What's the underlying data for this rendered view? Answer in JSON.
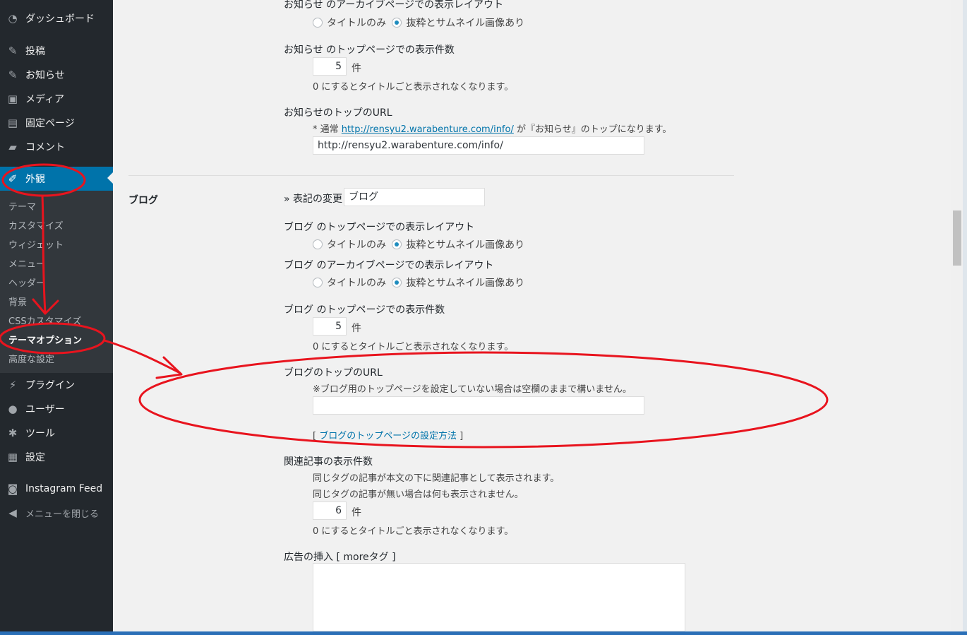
{
  "sidebar": {
    "items": [
      {
        "label": "ダッシュボード",
        "icon": "dashboard-icon"
      },
      {
        "label": "投稿",
        "icon": "pin-icon"
      },
      {
        "label": "お知らせ",
        "icon": "pin-icon"
      },
      {
        "label": "メディア",
        "icon": "media-icon"
      },
      {
        "label": "固定ページ",
        "icon": "page-icon"
      },
      {
        "label": "コメント",
        "icon": "comment-icon"
      },
      {
        "label": "外観",
        "icon": "brush-icon"
      },
      {
        "label": "プラグイン",
        "icon": "plugin-icon"
      },
      {
        "label": "ユーザー",
        "icon": "user-icon"
      },
      {
        "label": "ツール",
        "icon": "wrench-icon"
      },
      {
        "label": "設定",
        "icon": "settings-icon"
      },
      {
        "label": "Instagram Feed",
        "icon": "camera-icon"
      }
    ],
    "submenu": [
      "テーマ",
      "カスタマイズ",
      "ウィジェット",
      "メニュー",
      "ヘッダー",
      "背景",
      "CSSカスタマイズ",
      "テーマオプション",
      "高度な設定"
    ],
    "collapse_label": "メニューを閉じる"
  },
  "info": {
    "archive_layout_label": "お知らせ のアーカイブページでの表示レイアウト",
    "option_title_only": "タイトルのみ",
    "option_excerpt": "抜粋とサムネイル画像あり",
    "top_count_label": "お知らせ のトップページでの表示件数",
    "top_count_value": "5",
    "unit": "件",
    "zero_note": "0 にするとタイトルごと表示されなくなります。",
    "url_label": "お知らせのトップのURL",
    "url_note_prefix": "* 通常",
    "url_note_link": "http://rensyu2.warabenture.com/info/",
    "url_note_suffix": "が『お知らせ』のトップになります。",
    "url_value": "http://rensyu2.warabenture.com/info/"
  },
  "blog": {
    "section_title": "ブログ",
    "rename_label": "» 表記の変更",
    "rename_value": "ブログ",
    "top_layout_label": "ブログ のトップページでの表示レイアウト",
    "archive_layout_label": "ブログ のアーカイブページでの表示レイアウト",
    "option_title_only": "タイトルのみ",
    "option_excerpt": "抜粋とサムネイル画像あり",
    "top_count_label": "ブログ のトップページでの表示件数",
    "top_count_value": "5",
    "unit": "件",
    "zero_note": "0 にするとタイトルごと表示されなくなります。",
    "url_label": "ブログのトップのURL",
    "url_note": "※ブログ用のトップページを設定していない場合は空欄のままで構いません。",
    "url_value": "",
    "howto_open": "[",
    "howto_link": "ブログのトップページの設定方法",
    "howto_close": "]"
  },
  "related": {
    "label": "関連記事の表示件数",
    "note1": "同じタグの記事が本文の下に関連記事として表示されます。",
    "note2": "同じタグの記事が無い場合は何も表示されません。",
    "value": "6",
    "unit": "件",
    "zero_note": "0 にするとタイトルごと表示されなくなります。"
  },
  "ad": {
    "label": "広告の挿入 [ moreタグ ]"
  },
  "colors": {
    "sidebar_bg": "#23282d",
    "accent": "#0073aa",
    "annotation": "#e8141e"
  }
}
